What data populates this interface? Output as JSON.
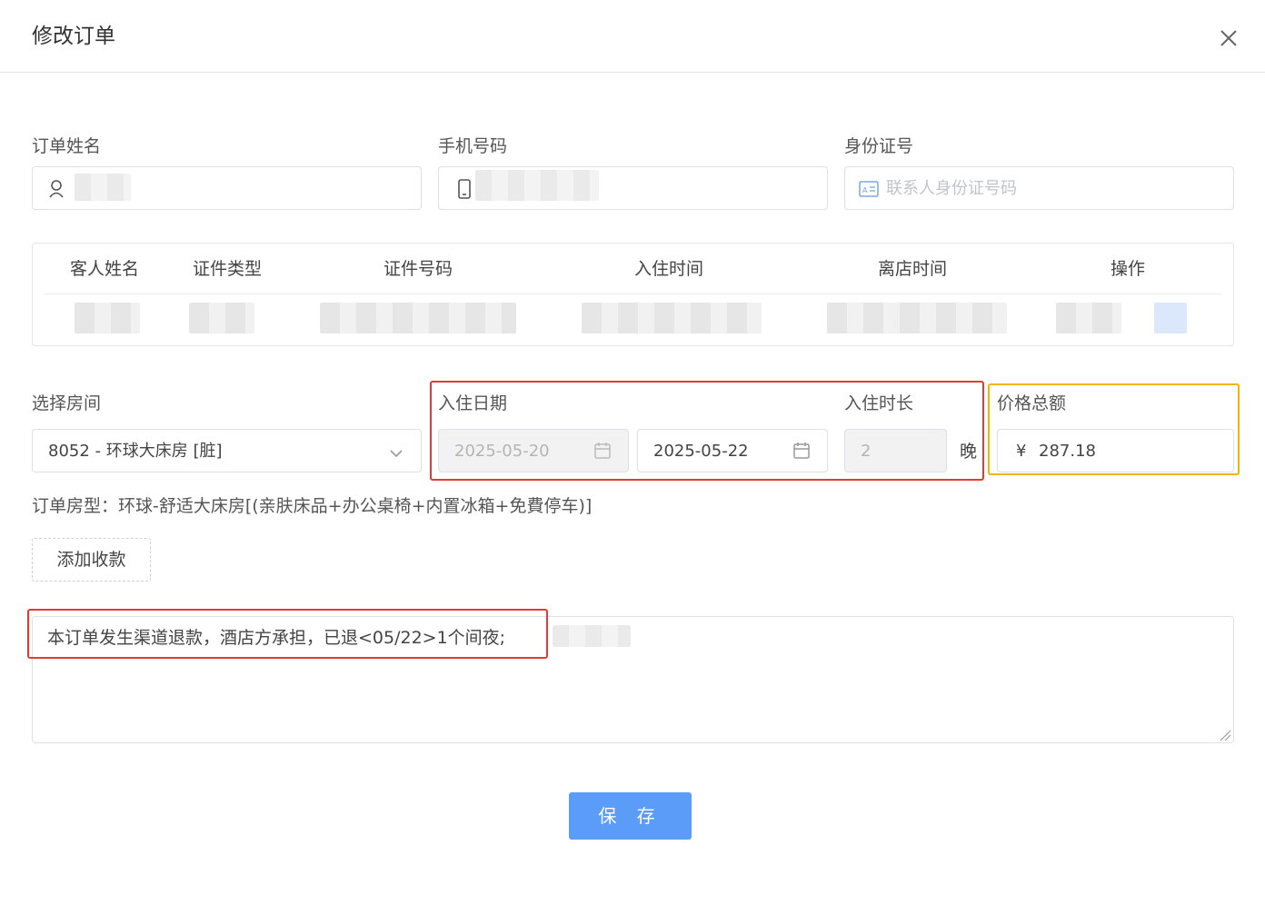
{
  "dialog": {
    "title": "修改订单"
  },
  "fields": {
    "order_name_label": "订单姓名",
    "phone_label": "手机号码",
    "id_label": "身份证号",
    "id_placeholder": "联系人身份证号码"
  },
  "guest_table": {
    "headers": [
      "客人姓名",
      "证件类型",
      "证件号码",
      "入住时间",
      "离店时间",
      "操作"
    ]
  },
  "room": {
    "label": "选择房间",
    "selected": "8052 - 环球大床房 [脏]"
  },
  "stay": {
    "checkin_label": "入住日期",
    "checkin_date": "2025-05-20",
    "checkout_date": "2025-05-22",
    "duration_label": "入住时长",
    "duration_value": "2",
    "duration_unit": "晚"
  },
  "price": {
    "label": "价格总额",
    "currency": "¥",
    "value": "287.18"
  },
  "room_type": {
    "text": "订单房型：环球-舒适大床房[(亲肤床品+办公桌椅+内置冰箱+免費停车)]"
  },
  "actions": {
    "add_payment": "添加收款",
    "save": "保 存"
  },
  "remark": {
    "text": "本订单发生渠道退款，酒店方承担，已退<05/22>1个间夜;"
  },
  "colors": {
    "primary": "#5b9cf8",
    "highlight_red": "#e53935",
    "highlight_yellow": "#f4b400"
  }
}
